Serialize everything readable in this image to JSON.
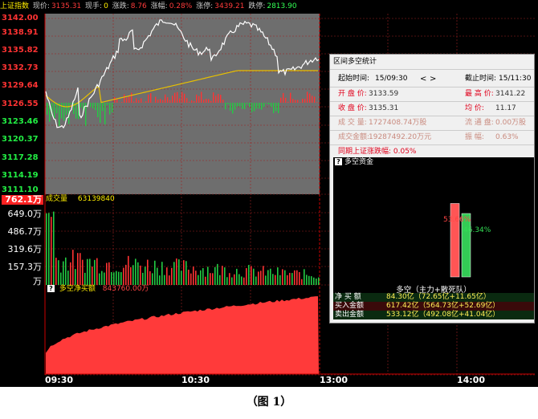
{
  "header": {
    "index_name": "上证指数",
    "price_label": "现价:",
    "price_value": "3135.31",
    "volume_label": "现手:",
    "volume_value": "0",
    "change_label": "涨跌:",
    "change_value": "8.76",
    "pct_label": "涨幅:",
    "pct_value": "0.28%",
    "limit_up_label": "涨停:",
    "limit_up_value": "3439.21",
    "limit_down_label": "跌停:",
    "limit_down_value": "2813.90"
  },
  "price_axis": {
    "ticks": [
      "3142.00",
      "3138.91",
      "3135.82",
      "3132.73",
      "3129.64",
      "3126.55",
      "3123.46",
      "3120.37",
      "3117.28",
      "3114.19",
      "3111.10"
    ],
    "reference": 3126.55
  },
  "volume_panel": {
    "title": "成交量",
    "value": "63139840",
    "max_label": "762.1万",
    "ticks": [
      "649.0万",
      "486.7万",
      "319.6万",
      "157.3万",
      "万"
    ]
  },
  "net_buy_panel": {
    "title": "多空净买额",
    "value": "843760.00万",
    "icon": "question-icon"
  },
  "time_axis": [
    "09:30",
    "10:30",
    "13:00",
    "14:00"
  ],
  "stats_panel": {
    "title": "区间多空统计",
    "start_label": "起始时间:",
    "start_value": "15/09:30",
    "prev_glyph": "<",
    "next_glyph": ">",
    "end_label": "截止时间:",
    "end_value": "15/11:30",
    "open_label": "开 盘 价:",
    "open_value": "3133.59",
    "high_label": "最 高 价:",
    "high_value": "3141.22",
    "close_label": "收 盘 价:",
    "close_value": "3135.31",
    "avg_label": "均     价:",
    "avg_value": "11.17",
    "vol_label": "成 交 量:",
    "vol_value": "1727408.74万股",
    "float_label": "流 通 盘:",
    "float_value": "0.00万股",
    "amount_label": "成交金额:",
    "amount_value": "19287492.20万元",
    "amp_label": "振     幅:",
    "amp_value": "0.63%",
    "same_period": "同期上证涨跌幅: 0.05%"
  },
  "fund_panel": {
    "title": "多空资金",
    "bull_pct": "53.66%",
    "bear_pct": "46.34%",
    "bull_fraction": 0.5366,
    "bear_fraction": 0.4634,
    "subtitle": "多空（主力+散死队）",
    "rows": [
      {
        "label": "净 买 额",
        "value": "84.30亿（72.65亿+11.65亿）"
      },
      {
        "label": "买入金额",
        "value": "617.42亿（564.73亿+52.69亿）"
      },
      {
        "label": "卖出金额",
        "value": "533.12亿（492.08亿+41.04亿）"
      }
    ]
  },
  "caption": "（图 1）",
  "colors": {
    "up": "#ff3333",
    "down": "#22cc44",
    "price_line": "#ffffff",
    "avg_line": "#e8c000",
    "net_fill": "#ff3a3a"
  }
}
